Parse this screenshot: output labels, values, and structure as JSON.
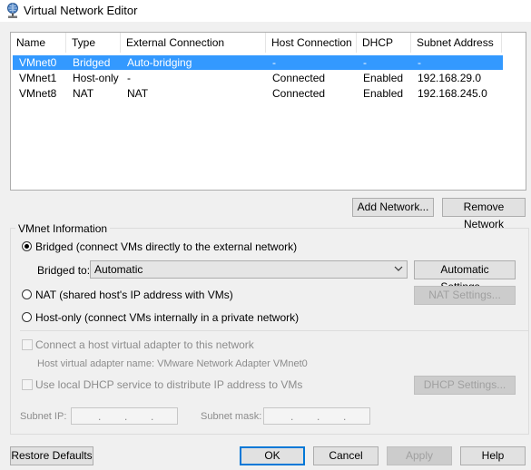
{
  "window": {
    "title": "Virtual Network Editor",
    "icon": "network-globe-icon"
  },
  "table": {
    "columns": [
      "Name",
      "Type",
      "External Connection",
      "Host Connection",
      "DHCP",
      "Subnet Address"
    ],
    "rows": [
      {
        "name": "VMnet0",
        "type": "Bridged",
        "external": "Auto-bridging",
        "host": "-",
        "dhcp": "-",
        "subnet": "-",
        "selected": true
      },
      {
        "name": "VMnet1",
        "type": "Host-only",
        "external": "-",
        "host": "Connected",
        "dhcp": "Enabled",
        "subnet": "192.168.29.0",
        "selected": false
      },
      {
        "name": "VMnet8",
        "type": "NAT",
        "external": "NAT",
        "host": "Connected",
        "dhcp": "Enabled",
        "subnet": "192.168.245.0",
        "selected": false
      }
    ],
    "selection_color": "#3399ff"
  },
  "list_buttons": {
    "add_network": "Add Network...",
    "remove_network": "Remove Network"
  },
  "vmnet_info": {
    "title": "VMnet Information",
    "bridged_label": "Bridged (connect VMs directly to the external network)",
    "bridged_to_label": "Bridged to:",
    "bridged_to_value": "Automatic",
    "automatic_settings": "Automatic Settings...",
    "nat_label": "NAT (shared host's IP address with VMs)",
    "nat_settings": "NAT Settings...",
    "hostonly_label": "Host-only (connect VMs internally in a private network)",
    "connect_adapter_label": "Connect a host virtual adapter to this network",
    "adapter_name_label": "Host virtual adapter name: VMware Network Adapter VMnet0",
    "dhcp_label": "Use local DHCP service to distribute IP address to VMs",
    "dhcp_settings": "DHCP Settings...",
    "subnet_ip_label": "Subnet IP:",
    "subnet_mask_label": "Subnet mask:",
    "ip_dot": "."
  },
  "footer": {
    "restore_defaults": "Restore Defaults",
    "ok": "OK",
    "cancel": "Cancel",
    "apply": "Apply",
    "help": "Help"
  },
  "colors": {
    "accent": "#0078d7",
    "window_bg": "#f0f0f0"
  }
}
